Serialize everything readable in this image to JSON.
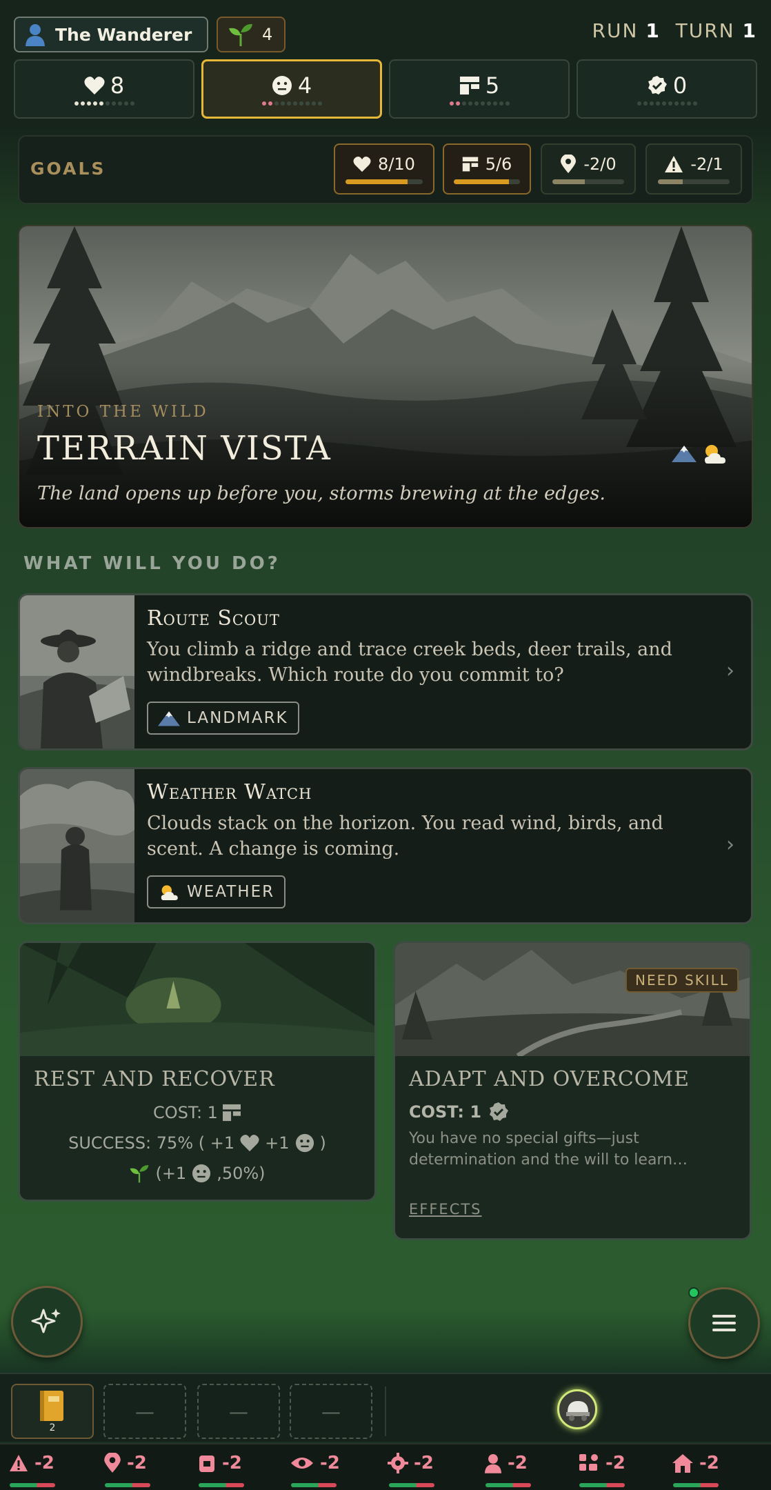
{
  "header": {
    "character_name": "The Wanderer",
    "sprout_count": "4",
    "run_label": "RUN",
    "run_value": "1",
    "turn_label": "TURN",
    "turn_value": "1"
  },
  "stats": [
    {
      "icon": "heart-icon",
      "value": "8",
      "dots": "white-5-of-10",
      "active": false
    },
    {
      "icon": "face-icon",
      "value": "4",
      "dots": "pink-2-of-10",
      "active": true
    },
    {
      "icon": "supplies-icon",
      "value": "5",
      "dots": "pink-2-of-10",
      "active": false
    },
    {
      "icon": "skill-check-icon",
      "value": "0",
      "dots": "0-of-10",
      "active": false
    }
  ],
  "goals": {
    "label": "GOALS",
    "items": [
      {
        "icon": "heart-icon",
        "text": "8/10",
        "progress": 0.8
      },
      {
        "icon": "supplies-icon",
        "text": "5/6",
        "progress": 0.83
      },
      {
        "icon": "location-pin-icon",
        "text": "-2/0",
        "progress": 0.45
      },
      {
        "icon": "warning-icon",
        "text": "-2/1",
        "progress": 0.35
      }
    ]
  },
  "scene": {
    "kicker": "INTO THE WILD",
    "title": "TERRAIN VISTA",
    "subtitle": "The land opens up before you, storms brewing at the edges.",
    "icons": [
      "mountain-icon",
      "sun-cloud-icon"
    ]
  },
  "prompt": "WHAT WILL YOU DO?",
  "actions": [
    {
      "title": "Route Scout",
      "desc": "You climb a ridge and trace creek beds, deer trails, and windbreaks. Which route do you commit to?",
      "tag": "LANDMARK",
      "tag_icon": "mountain-icon"
    },
    {
      "title": "Weather Watch",
      "desc": "Clouds stack on the horizon. You read wind, birds, and scent. A change is coming.",
      "tag": "WEATHER",
      "tag_icon": "sun-cloud-icon"
    }
  ],
  "rest": {
    "title": "REST AND RECOVER",
    "cost_label": "COST: 1",
    "success_prefix": "SUCCESS: 75% ( +1",
    "success_mid": "+1",
    "success_end": ")",
    "bonus_prefix": "(+1",
    "bonus_end": ",50%)"
  },
  "adapt": {
    "badge": "NEED SKILL",
    "title": "ADAPT AND OVERCOME",
    "cost_label": "COST: 1",
    "desc": "You have no special gifts—just determination and the will to learn…",
    "effects": "EFFECTS"
  },
  "inventory": {
    "journal_count": "2",
    "empty_slot": "—"
  },
  "bottom_stats": [
    {
      "icon": "warning-icon",
      "value": "-2"
    },
    {
      "icon": "location-pin-icon",
      "value": "-2"
    },
    {
      "icon": "pack-icon",
      "value": "-2"
    },
    {
      "icon": "eye-icon",
      "value": "-2"
    },
    {
      "icon": "gear-icon",
      "value": "-2"
    },
    {
      "icon": "person-icon",
      "value": "-2"
    },
    {
      "icon": "group-icon",
      "value": "-2"
    },
    {
      "icon": "home-icon",
      "value": "-2"
    }
  ],
  "colors": {
    "accent_gold": "#e6b83a",
    "progress_gold": "#d89b1f",
    "negative_pink": "#f08a9a",
    "online_green": "#22c55e"
  }
}
